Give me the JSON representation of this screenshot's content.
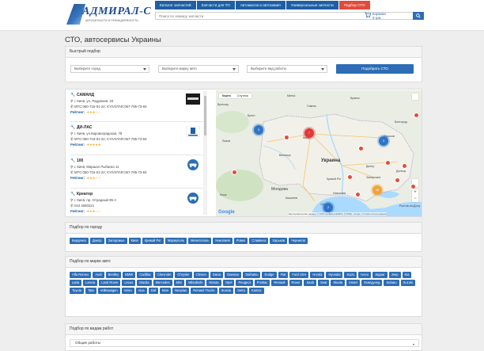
{
  "header": {
    "logo_text": "АДМИРАЛ-С",
    "logo_sub": "АВТОЗАПЧАСТИ И ПРИНАДЛЕЖНОСТИ",
    "nav": [
      "Каталог запчастей",
      "Запчасти для ТО",
      "Автомасла и автохимия",
      "Универсальные запчасти",
      "Подбор СТО"
    ],
    "search_placeholder": "Поиск по номеру запчасти",
    "cart_label": "Корзина",
    "cart_sum": "0 грн."
  },
  "page_title": "СТО, автосервисы Украины",
  "quick": {
    "title": "Быстрый подбор",
    "city_placeholder": "Выберите город",
    "brand_placeholder": "Выберите марку авто",
    "work_placeholder": "Выберите вид работы",
    "submit": "Подобрать СТО"
  },
  "stations": [
    {
      "name": "САМАНД",
      "address": "г. Киев, ул. Радужная, 33",
      "phones": "МТС:050-715-01-22; KYIVSTAR:067-795-73-93",
      "rating_label": "Рейтинг:",
      "stars": "★★★☆☆"
    },
    {
      "name": "ДИ-ЛАС",
      "address": "г. Киев, ул.Кировоградская, 78",
      "phones": "МТС:050-715-01-22; KYIVSTAR:067-795-73-93",
      "rating_label": "Рейтинг:",
      "stars": "★★★★★"
    },
    {
      "name": "100",
      "address": "г. Киев, Маршал Рыбалко 11",
      "phones": "МТС:050-715-01-22; KYIVSTAR:067-795-73-93",
      "rating_label": "Рейтинг:",
      "stars": "★★★☆☆"
    },
    {
      "name": "Креатор",
      "address": "г. Киев, пр. Отрадный 95-А",
      "phones": "044 4560221",
      "rating_label": "Рейтинг:",
      "stars": "★★★☆☆"
    }
  ],
  "map": {
    "tab_map": "Карта",
    "tab_sat": "Спутник",
    "country": "Украина",
    "cities": [
      "Минск",
      "Брест",
      "Гомель",
      "Брянск",
      "Киев",
      "Харьков",
      "Львов",
      "Винница",
      "Днепр",
      "Донецк",
      "Запорожье",
      "Кривой Рог",
      "Николаев",
      "Одесса",
      "Молдова",
      "Кишинев",
      "Клуж",
      "Бреслау",
      "Белгород",
      "Ростов-на-Дону"
    ],
    "clusters": [
      "5",
      "7",
      "3",
      "18",
      "2"
    ],
    "attribution": "Картографические данные © 2018 GeoBasis-DE/BKG (©2009), Google | Условия использования",
    "google": "Google"
  },
  "city_panel": {
    "title": "Подбор по городу",
    "items": [
      "Бердянск",
      "Днепр",
      "Запорожье",
      "Киев",
      "Кривой Рог",
      "Мариуполь",
      "Мелитополь",
      "Николаев",
      "Ровно",
      "Славянск",
      "Харьков",
      "Чернигов"
    ]
  },
  "brand_panel": {
    "title": "Подбор по марке авто",
    "items": [
      "Alfa Romeo",
      "Audi",
      "Bentley",
      "BMW",
      "Cadillac",
      "Chevrolet",
      "Chrysler",
      "Citroen",
      "Dacia",
      "Daewoo",
      "Daihatsu",
      "Dodge",
      "Fiat",
      "Ford USA",
      "Honda",
      "Hyundai",
      "Isuzu",
      "Iveco",
      "Jaguar",
      "Jeep",
      "Kia",
      "Lada",
      "Lancia",
      "Land Rover",
      "Lexus",
      "Mazda",
      "Mercedes",
      "Mini",
      "Mitsubishi",
      "Nissan",
      "Opel",
      "Peugeot",
      "Pontiac",
      "Renault",
      "Rover",
      "Saab",
      "Seat",
      "Skoda",
      "Smart",
      "Ssangyong",
      "Subaru",
      "Suzuki",
      "Toyota",
      "Tata",
      "Volkswagen",
      "Volvo",
      "Aixa",
      "Daf",
      "Man",
      "Neoplan",
      "Renault Trucks",
      "Scania",
      "Setra",
      "Kamaz"
    ]
  },
  "work_panel": {
    "title": "Подбор по видам работ",
    "first": "Общие работы"
  },
  "colors": {
    "primary": "#2d6db5",
    "accent": "#e14a3a",
    "star": "#f0ad2e"
  }
}
